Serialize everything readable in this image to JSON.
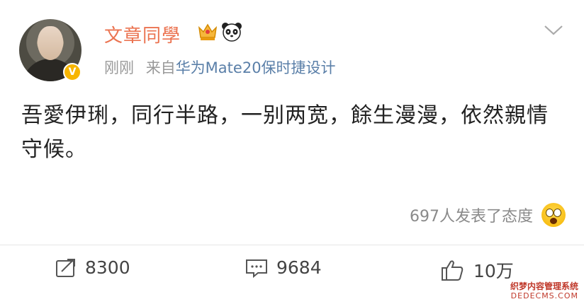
{
  "post": {
    "username": "文章同學",
    "time": "刚刚",
    "source_prefix": "来自",
    "source": "华为Mate20保时捷设计",
    "text": "吾愛伊琍，同行半路，一别两宽，餘生漫漫，依然親情守候。",
    "verified_badge": "V",
    "icons": [
      "crown-icon",
      "panda-icon",
      "chevron-down-icon"
    ]
  },
  "reactions": {
    "summary": "697人发表了态度",
    "emoji": "surprised-emoji-icon"
  },
  "actions": {
    "repost_count": "8300",
    "comment_count": "9684",
    "like_count": "10万"
  },
  "watermark": {
    "line1": "织梦内容管理系统",
    "line2": "DEDECMS.COM"
  },
  "colors": {
    "username": "#eb7350",
    "source_link": "#5a7fa8",
    "meta": "#999999"
  }
}
